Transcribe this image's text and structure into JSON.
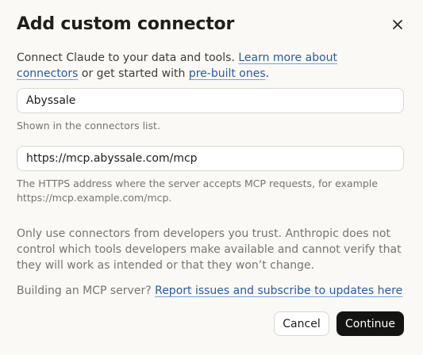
{
  "dialog": {
    "title": "Add custom connector",
    "close_icon": "close-icon",
    "intro_text_1": "Connect Claude to your data and tools. ",
    "intro_link_1": "Learn more about connectors",
    "intro_text_2": " or get started with ",
    "intro_link_2": "pre-built ones",
    "intro_text_3": "."
  },
  "name_field": {
    "value": "Abyssale",
    "hint": "Shown in the connectors list."
  },
  "url_field": {
    "value": "https://mcp.abyssale.com/mcp",
    "hint": "The HTTPS address where the server accepts MCP requests, for example https://mcp.example.com/mcp."
  },
  "warning_text": "Only use connectors from developers you trust. Anthropic does not control which tools developers make available and cannot verify that they will work as intended or that they won’t change.",
  "building": {
    "prefix": "Building an MCP server? ",
    "link": "Report issues and subscribe to updates here"
  },
  "actions": {
    "cancel_label": "Cancel",
    "continue_label": "Continue"
  },
  "colors": {
    "background": "#faf9f5",
    "link": "#2c5aa0",
    "primary_button": "#141413"
  }
}
